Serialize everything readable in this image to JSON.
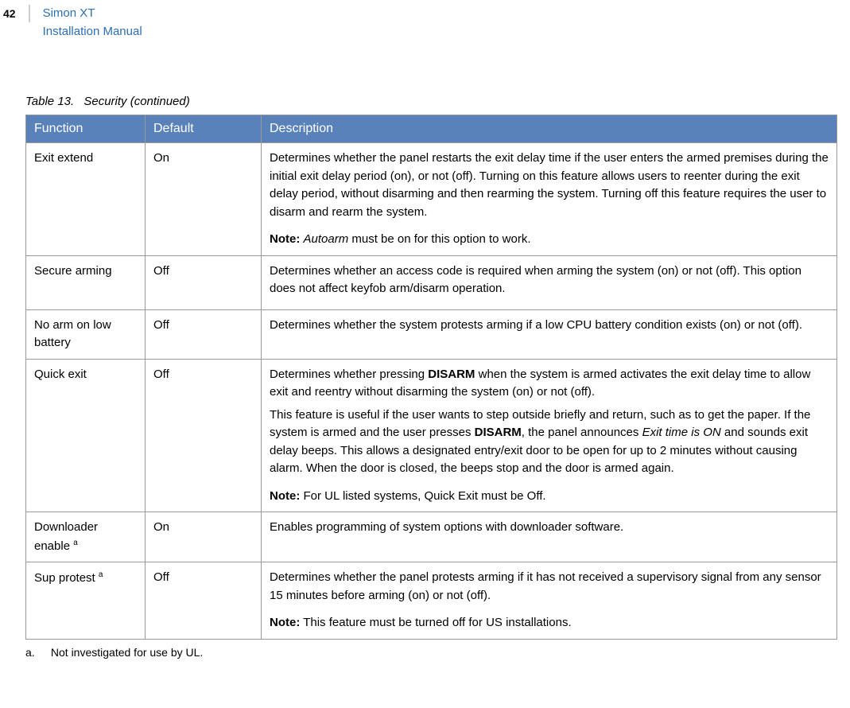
{
  "header": {
    "page_number": "42",
    "title_line1": "Simon XT",
    "title_line2": "Installation Manual"
  },
  "caption": {
    "number": "Table 13.",
    "text": "Security (continued)"
  },
  "table": {
    "columns": {
      "function": "Function",
      "default": "Default",
      "description": "Description"
    },
    "rows": [
      {
        "function": "Exit extend",
        "default": "On",
        "desc_main": "Determines whether the panel restarts the exit delay time if the user enters the armed premises during the initial exit delay period (on), or not (off). Turning on this feature allows users to reenter during the exit delay period, without disarming and then rearming the system. Turning off this feature requires the user to disarm and rearm the system.",
        "note_label": "Note:",
        "note_pre": "  ",
        "note_italic": "Autoarm",
        "note_post": " must be on for this option to work."
      },
      {
        "function": "Secure arming",
        "default": "Off",
        "desc_main": "Determines whether an access code is required when arming the system  (on) or not (off). This option does not affect keyfob arm/disarm operation."
      },
      {
        "function": "No arm on low battery",
        "default": "Off",
        "desc_main": "Determines whether the system protests arming if a low CPU battery condition exists (on) or not (off)."
      },
      {
        "function": "Quick exit",
        "default": "Off",
        "desc1_pre": "Determines whether pressing ",
        "desc1_bold1": "DISARM",
        "desc1_post1": " when the system is armed activates the exit delay time to allow exit and reentry without disarming the system (on) or not (off).",
        "desc2_pre": "This feature is useful if the user wants to step outside briefly and return, such as to get the paper.  If the system is armed and the user presses ",
        "desc2_bold1": "DISARM",
        "desc2_mid": ", the panel announces ",
        "desc2_italic": "Exit time is ON",
        "desc2_post": " and sounds exit delay beeps.  This allows a designated entry/exit door to be open for up to 2 minutes without causing alarm.  When the door is closed, the beeps stop and the door is armed again.",
        "note_label": "Note:",
        "note_text": "  For UL listed systems, Quick Exit must be Off."
      },
      {
        "function": "Downloader enable ",
        "function_sup": "a",
        "default": "On",
        "desc_main": "Enables programming of system options with downloader software."
      },
      {
        "function": "Sup protest ",
        "function_sup": "a",
        "default": "Off",
        "desc_main": "Determines whether the panel protests arming if it has not received a supervisory signal from any sensor 15 minutes before arming (on) or not (off).",
        "note_label": "Note:",
        "note_text": "  This feature must be turned off for US installations."
      }
    ]
  },
  "footnote": {
    "letter": "a.",
    "text": "Not investigated for use by UL."
  }
}
